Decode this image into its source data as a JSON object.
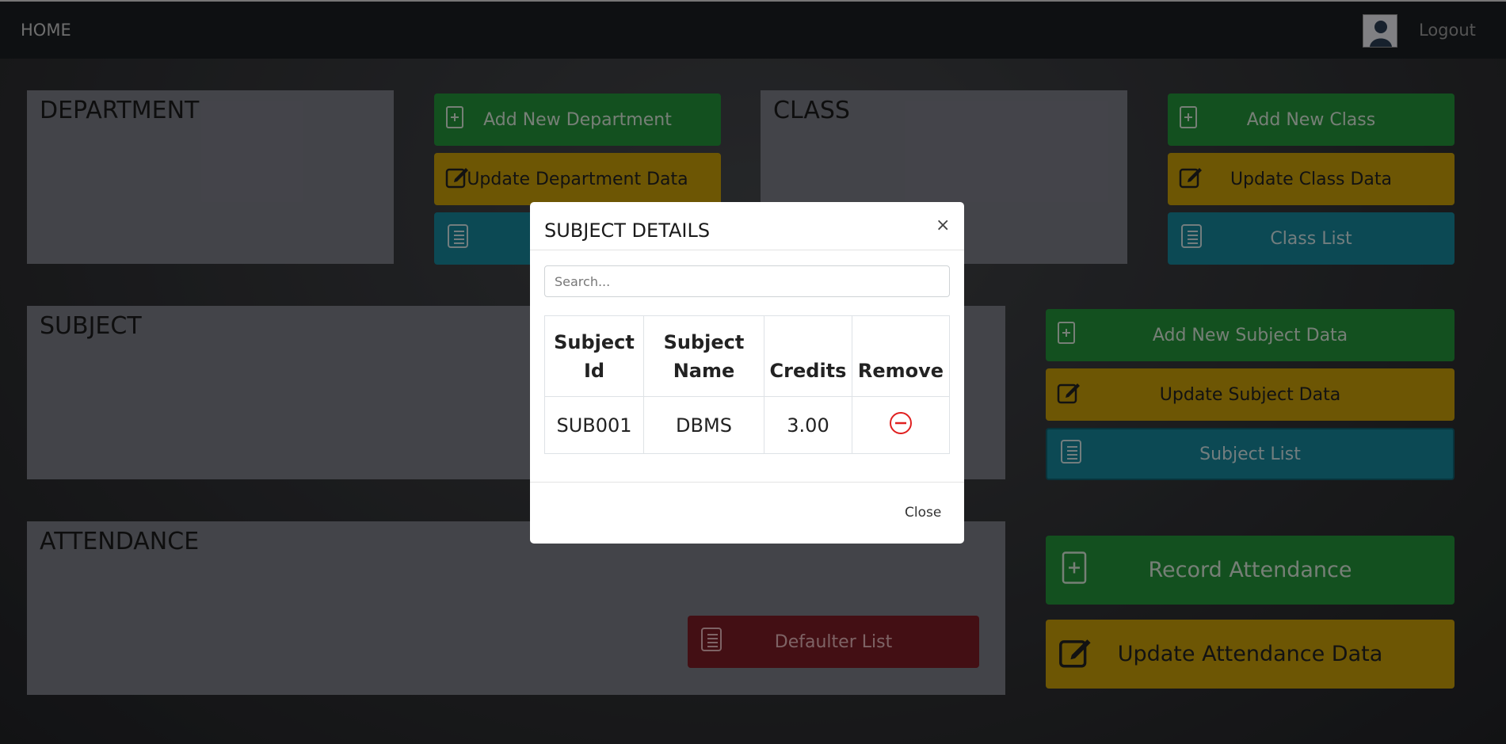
{
  "nav": {
    "home": "HOME",
    "logout": "Logout"
  },
  "panels": {
    "department": "DEPARTMENT",
    "class": "CLASS",
    "subject": "SUBJECT",
    "attendance": "ATTENDANCE"
  },
  "buttons": {
    "add_department": "Add New Department",
    "update_department": "Update Department Data",
    "add_class": "Add New Class",
    "update_class": "Update Class Data",
    "class_list": "Class List",
    "add_subject": "Add New Subject Data",
    "update_subject": "Update Subject Data",
    "subject_list": "Subject List",
    "record_attendance": "Record Attendance",
    "update_attendance": "Update Attendance Data",
    "defaulter_list": "Defaulter List"
  },
  "modal": {
    "title": "SUBJECT DETAILS",
    "close_x": "×",
    "search_placeholder": "Search...",
    "columns": [
      "Subject Id",
      "Subject Name",
      "Credits",
      "Remove"
    ],
    "rows": [
      {
        "id": "SUB001",
        "name": "DBMS",
        "credits": "3.00"
      }
    ],
    "close_button": "Close"
  }
}
